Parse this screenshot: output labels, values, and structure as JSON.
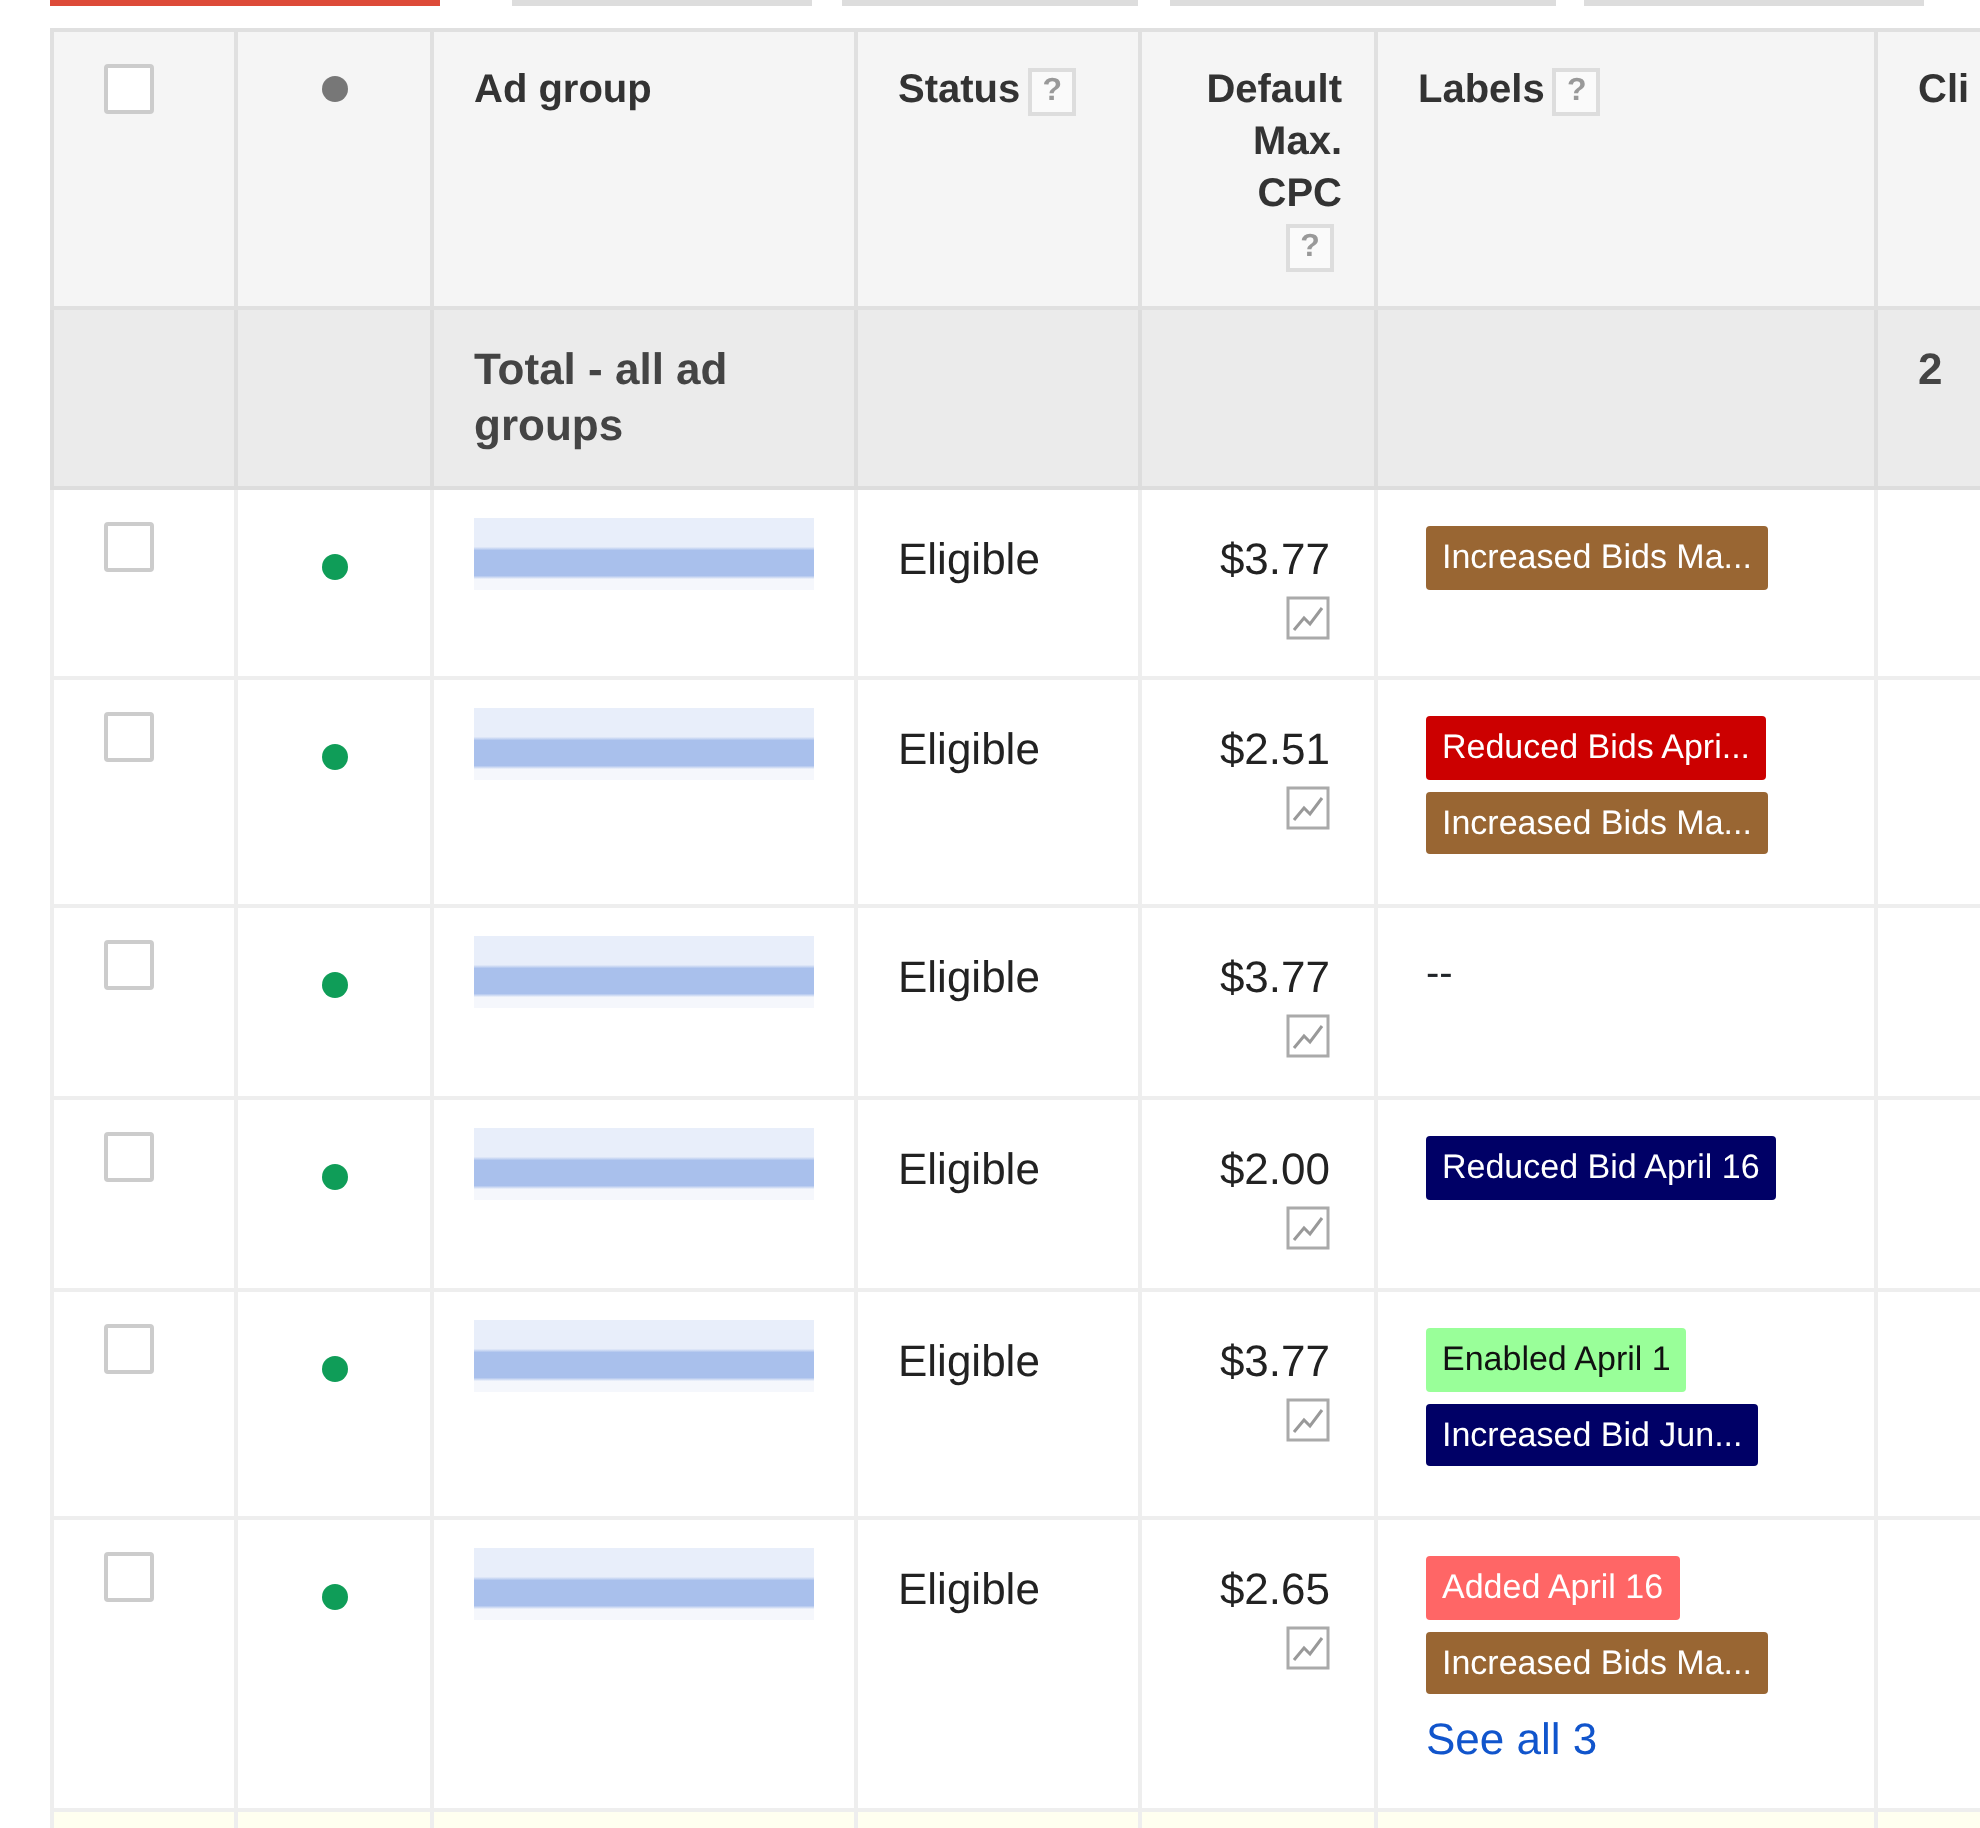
{
  "tabs": [
    {
      "selected": true
    },
    {
      "selected": false
    },
    {
      "selected": false
    },
    {
      "selected": false
    },
    {
      "selected": false
    }
  ],
  "table": {
    "columns": [
      {
        "kind": "checkbox",
        "checked": false
      },
      {
        "kind": "dot"
      },
      {
        "kind": "text",
        "label": "Ad group"
      },
      {
        "kind": "text",
        "label": "Status",
        "help": "?"
      },
      {
        "kind": "numeric",
        "label": "Default Max. CPC",
        "help": "?"
      },
      {
        "kind": "text",
        "label": "Labels",
        "help": "?"
      },
      {
        "kind": "text",
        "label": "Cli"
      }
    ],
    "total": {
      "label": "Total - all ad groups",
      "clicks": "2"
    },
    "rows": [
      {
        "checked": false,
        "enabled": true,
        "status": "Eligible",
        "max_cpc": "$3.77",
        "labels": [
          {
            "text": "Increased Bids Ma...",
            "color": "#996633"
          }
        ]
      },
      {
        "checked": false,
        "enabled": true,
        "status": "Eligible",
        "max_cpc": "$2.51",
        "labels": [
          {
            "text": "Reduced Bids Apri...",
            "color": "#cc0000"
          },
          {
            "text": "Increased Bids Ma...",
            "color": "#996633"
          }
        ]
      },
      {
        "checked": false,
        "enabled": true,
        "status": "Eligible",
        "max_cpc": "$3.77",
        "no_labels": "--"
      },
      {
        "checked": false,
        "enabled": true,
        "status": "Eligible",
        "max_cpc": "$2.00",
        "labels": [
          {
            "text": "Reduced Bid April 16",
            "color": "#000066"
          }
        ]
      },
      {
        "checked": false,
        "enabled": true,
        "status": "Eligible",
        "max_cpc": "$3.77",
        "labels": [
          {
            "text": "Enabled April 1",
            "color": "#99ff99"
          },
          {
            "text": "Increased Bid Jun...",
            "color": "#000066"
          }
        ]
      },
      {
        "checked": false,
        "enabled": true,
        "status": "Eligible",
        "max_cpc": "$2.65",
        "labels": [
          {
            "text": "Added April 16",
            "color": "#ff6666"
          },
          {
            "text": "Increased Bids Ma...",
            "color": "#996633"
          }
        ],
        "see_all": "See all 3"
      }
    ]
  }
}
